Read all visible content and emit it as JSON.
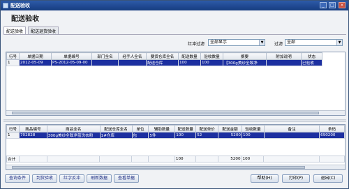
{
  "window": {
    "title": "配送验收",
    "min": "_",
    "max": "□",
    "close": "×"
  },
  "page_title": "配送验收",
  "tabs": [
    {
      "label": "配送验收"
    },
    {
      "label": "配送退货验收"
    }
  ],
  "filters": {
    "red_label": "红冲过滤",
    "red_value": "全部显示",
    "filter_label": "过滤",
    "filter_value": "全部"
  },
  "top_grid": {
    "headers": [
      "行号",
      "单据日期",
      "单据编号",
      "部门全名",
      "经手人全名",
      "要货仓库全名",
      "配送数量",
      "验收数量",
      "摘要",
      "附加说明",
      "状态"
    ],
    "rows": [
      [
        "1",
        "2012-05-09",
        "PS-2012-05-09-00",
        "",
        "",
        "配送仓库",
        "100",
        "100",
        "【300g美纱全致净",
        "",
        "已验收"
      ]
    ]
  },
  "bottom_grid": {
    "headers": [
      "行号",
      "商品编号",
      "商品全名",
      "配送仓库全名",
      "单位",
      "辅助数量",
      "配送数量",
      "配送单价",
      "配送金额",
      "验收数量",
      "备注",
      "条码"
    ],
    "rows": [
      [
        "1",
        "702828",
        "300g美纱全致净蓝洗衣粉",
        "1#仓库",
        "包",
        "5件",
        "100",
        "52",
        "5200",
        "100",
        "",
        "690200"
      ]
    ],
    "total": [
      "合计",
      "",
      "",
      "",
      "",
      "",
      "100",
      "",
      "5200",
      "100",
      "",
      ""
    ]
  },
  "footer": {
    "left_buttons": [
      "查询条件",
      "到货验收",
      "红字反冲",
      "刷新数据",
      "查看单据"
    ],
    "right_buttons": [
      "帮助(H)",
      "打印(P)",
      "退出(C)"
    ]
  }
}
